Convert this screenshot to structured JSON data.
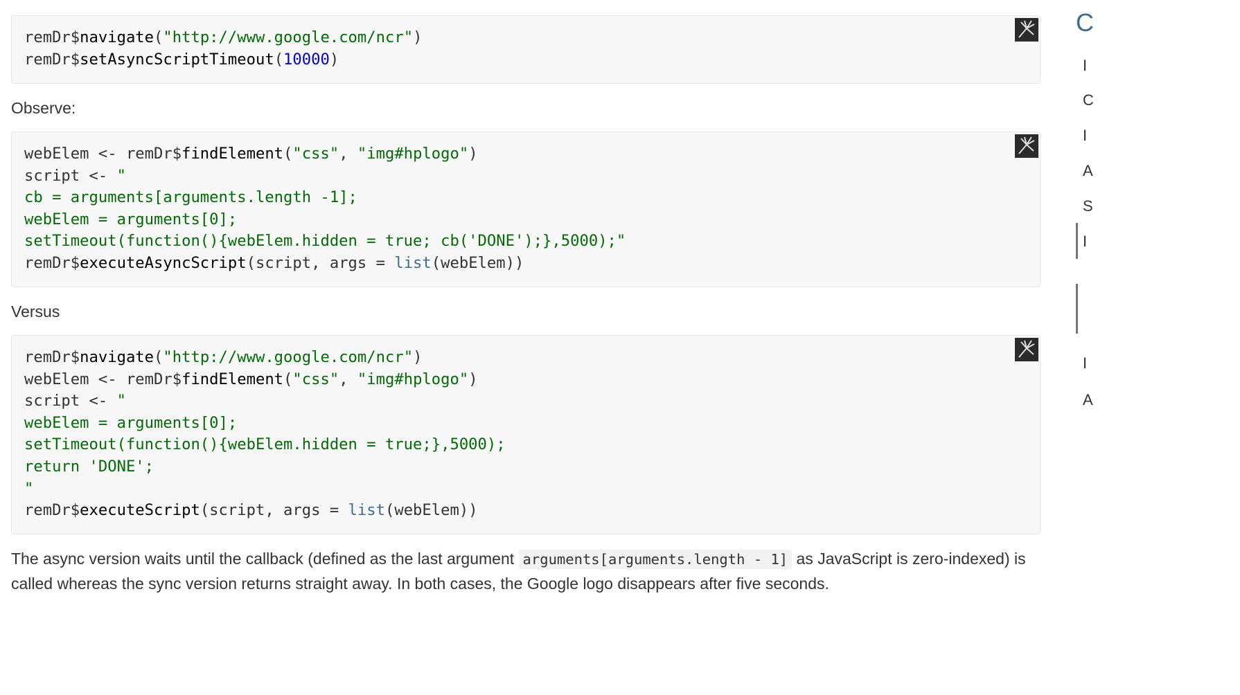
{
  "code_block_1": {
    "lines": [
      [
        {
          "t": "remDr$",
          "c": "plain"
        },
        {
          "t": "navigate",
          "c": "fn"
        },
        {
          "t": "(",
          "c": "plain"
        },
        {
          "t": "\"http://www.google.com/ncr\"",
          "c": "str"
        },
        {
          "t": ")",
          "c": "plain"
        }
      ],
      [
        {
          "t": "remDr$",
          "c": "plain"
        },
        {
          "t": "setAsyncScriptTimeout",
          "c": "fn"
        },
        {
          "t": "(",
          "c": "plain"
        },
        {
          "t": "10000",
          "c": "num"
        },
        {
          "t": ")",
          "c": "plain"
        }
      ]
    ]
  },
  "observe_text": "Observe:",
  "code_block_2": {
    "lines": [
      [
        {
          "t": "webElem <- remDr$",
          "c": "plain"
        },
        {
          "t": "findElement",
          "c": "fn"
        },
        {
          "t": "(",
          "c": "plain"
        },
        {
          "t": "\"css\"",
          "c": "str"
        },
        {
          "t": ", ",
          "c": "plain"
        },
        {
          "t": "\"img#hplogo\"",
          "c": "str"
        },
        {
          "t": ")",
          "c": "plain"
        }
      ],
      [
        {
          "t": "script <- ",
          "c": "plain"
        },
        {
          "t": "\"",
          "c": "str"
        }
      ],
      [
        {
          "t": "cb = arguments[arguments.length -1];",
          "c": "str"
        }
      ],
      [
        {
          "t": "webElem = arguments[0];",
          "c": "str"
        }
      ],
      [
        {
          "t": "setTimeout(function(){webElem.hidden = true; cb('DONE');},5000);\"",
          "c": "str"
        }
      ],
      [
        {
          "t": "remDr$",
          "c": "plain"
        },
        {
          "t": "executeAsyncScript",
          "c": "fn"
        },
        {
          "t": "(script, args = ",
          "c": "plain"
        },
        {
          "t": "list",
          "c": "kw"
        },
        {
          "t": "(webElem))",
          "c": "plain"
        }
      ]
    ]
  },
  "versus_text": "Versus",
  "code_block_3": {
    "lines": [
      [
        {
          "t": "remDr$",
          "c": "plain"
        },
        {
          "t": "navigate",
          "c": "fn"
        },
        {
          "t": "(",
          "c": "plain"
        },
        {
          "t": "\"http://www.google.com/ncr\"",
          "c": "str"
        },
        {
          "t": ")",
          "c": "plain"
        }
      ],
      [
        {
          "t": "webElem <- remDr$",
          "c": "plain"
        },
        {
          "t": "findElement",
          "c": "fn"
        },
        {
          "t": "(",
          "c": "plain"
        },
        {
          "t": "\"css\"",
          "c": "str"
        },
        {
          "t": ", ",
          "c": "plain"
        },
        {
          "t": "\"img#hplogo\"",
          "c": "str"
        },
        {
          "t": ")",
          "c": "plain"
        }
      ],
      [
        {
          "t": "script <- ",
          "c": "plain"
        },
        {
          "t": "\"",
          "c": "str"
        }
      ],
      [
        {
          "t": "webElem = arguments[0];",
          "c": "str"
        }
      ],
      [
        {
          "t": "setTimeout(function(){webElem.hidden = true;},5000);",
          "c": "str"
        }
      ],
      [
        {
          "t": "return 'DONE';",
          "c": "str"
        }
      ],
      [
        {
          "t": "\"",
          "c": "str"
        }
      ],
      [
        {
          "t": "remDr$",
          "c": "plain"
        },
        {
          "t": "executeScript",
          "c": "fn"
        },
        {
          "t": "(script, args = ",
          "c": "plain"
        },
        {
          "t": "list",
          "c": "kw"
        },
        {
          "t": "(webElem))",
          "c": "plain"
        }
      ]
    ]
  },
  "final_paragraph": {
    "before_code": "The async version waits until the callback (defined as the last argument ",
    "inline_code": "arguments[arguments.length - 1]",
    "after_code": " as JavaScript is zero-indexed) is called whereas the sync version returns straight away. In both cases, the Google logo disappears after five seconds."
  },
  "copy_button_icon": "copy-clipboard-icon",
  "toc": {
    "title": "C",
    "items": [
      "I",
      "C",
      "I",
      "A",
      "S",
      "I",
      "I",
      "A"
    ]
  },
  "colors": {
    "string": "#036a07",
    "number": "#0000cd",
    "keyword": "#3e6d8c",
    "function": "#000000",
    "code_background": "#f7f7f7"
  }
}
